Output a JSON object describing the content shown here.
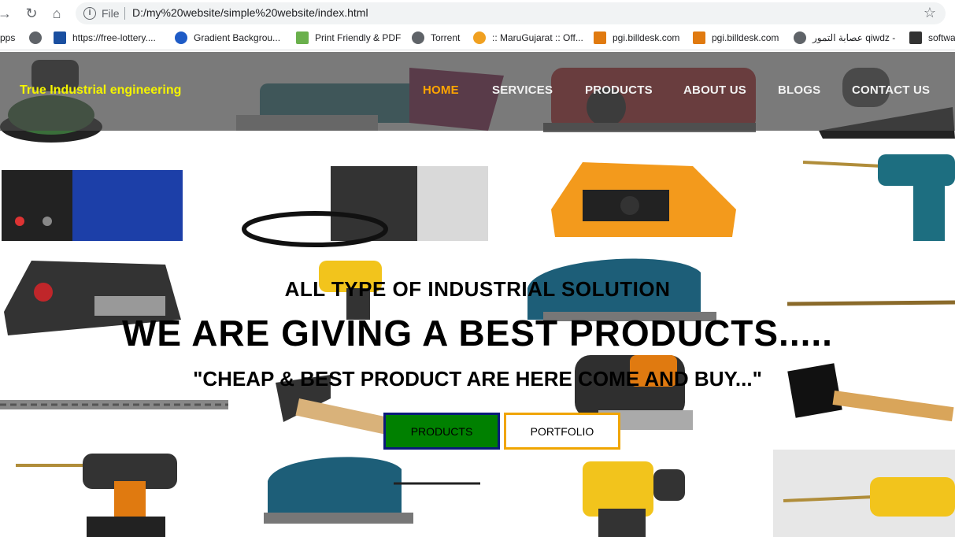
{
  "browser": {
    "file_label": "File",
    "url": "D:/my%20website/simple%20website/index.html",
    "bookmarks": [
      {
        "label": "pps",
        "icon": "apps-icon",
        "color": "#5f6368"
      },
      {
        "label": "",
        "icon": "globe-icon",
        "color": "#5f6368"
      },
      {
        "label": "https://free-lottery....",
        "icon": "lottery-icon",
        "color": "#1a4fa0"
      },
      {
        "label": "Gradient Backgrou...",
        "icon": "gradient-icon",
        "color": "#1e5bc6"
      },
      {
        "label": "Print Friendly & PDF",
        "icon": "printer-icon",
        "color": "#6ab04c"
      },
      {
        "label": "Torrent",
        "icon": "globe-icon",
        "color": "#5f6368"
      },
      {
        "label": ":: MaruGujarat :: Off...",
        "icon": "marugujarat-icon",
        "color": "#f0a020"
      },
      {
        "label": "pgi.billdesk.com",
        "icon": "billdesk-icon",
        "color": "#e07a10"
      },
      {
        "label": "pgi.billdesk.com",
        "icon": "billdesk-icon",
        "color": "#e07a10"
      },
      {
        "label": "عصابة التمور qiwdz -",
        "icon": "globe-icon",
        "color": "#5f6368"
      },
      {
        "label": "softwa",
        "icon": "software-icon",
        "color": "#333333"
      }
    ]
  },
  "header": {
    "logo": "True Industrial engineering",
    "nav": [
      "HOME",
      "SERVICES",
      "PRODUCTS",
      "ABOUT US",
      "BLOGS",
      "CONTACT US"
    ]
  },
  "hero": {
    "subtitle": "ALL TYPE OF INDUSTRIAL SOLUTION",
    "title": "WE ARE GIVING A BEST PRODUCTS.....",
    "tagline": "\"CHEAP & BEST PRODUCT ARE HERE COME AND BUY...\"",
    "buttons": {
      "products": "PRODUCTS",
      "portfolio": "PORTFOLIO"
    }
  },
  "colors": {
    "logo": "#f4f400",
    "nav_active": "#ffa500",
    "products_button": "#008000",
    "portfolio_border": "#f0a500"
  }
}
